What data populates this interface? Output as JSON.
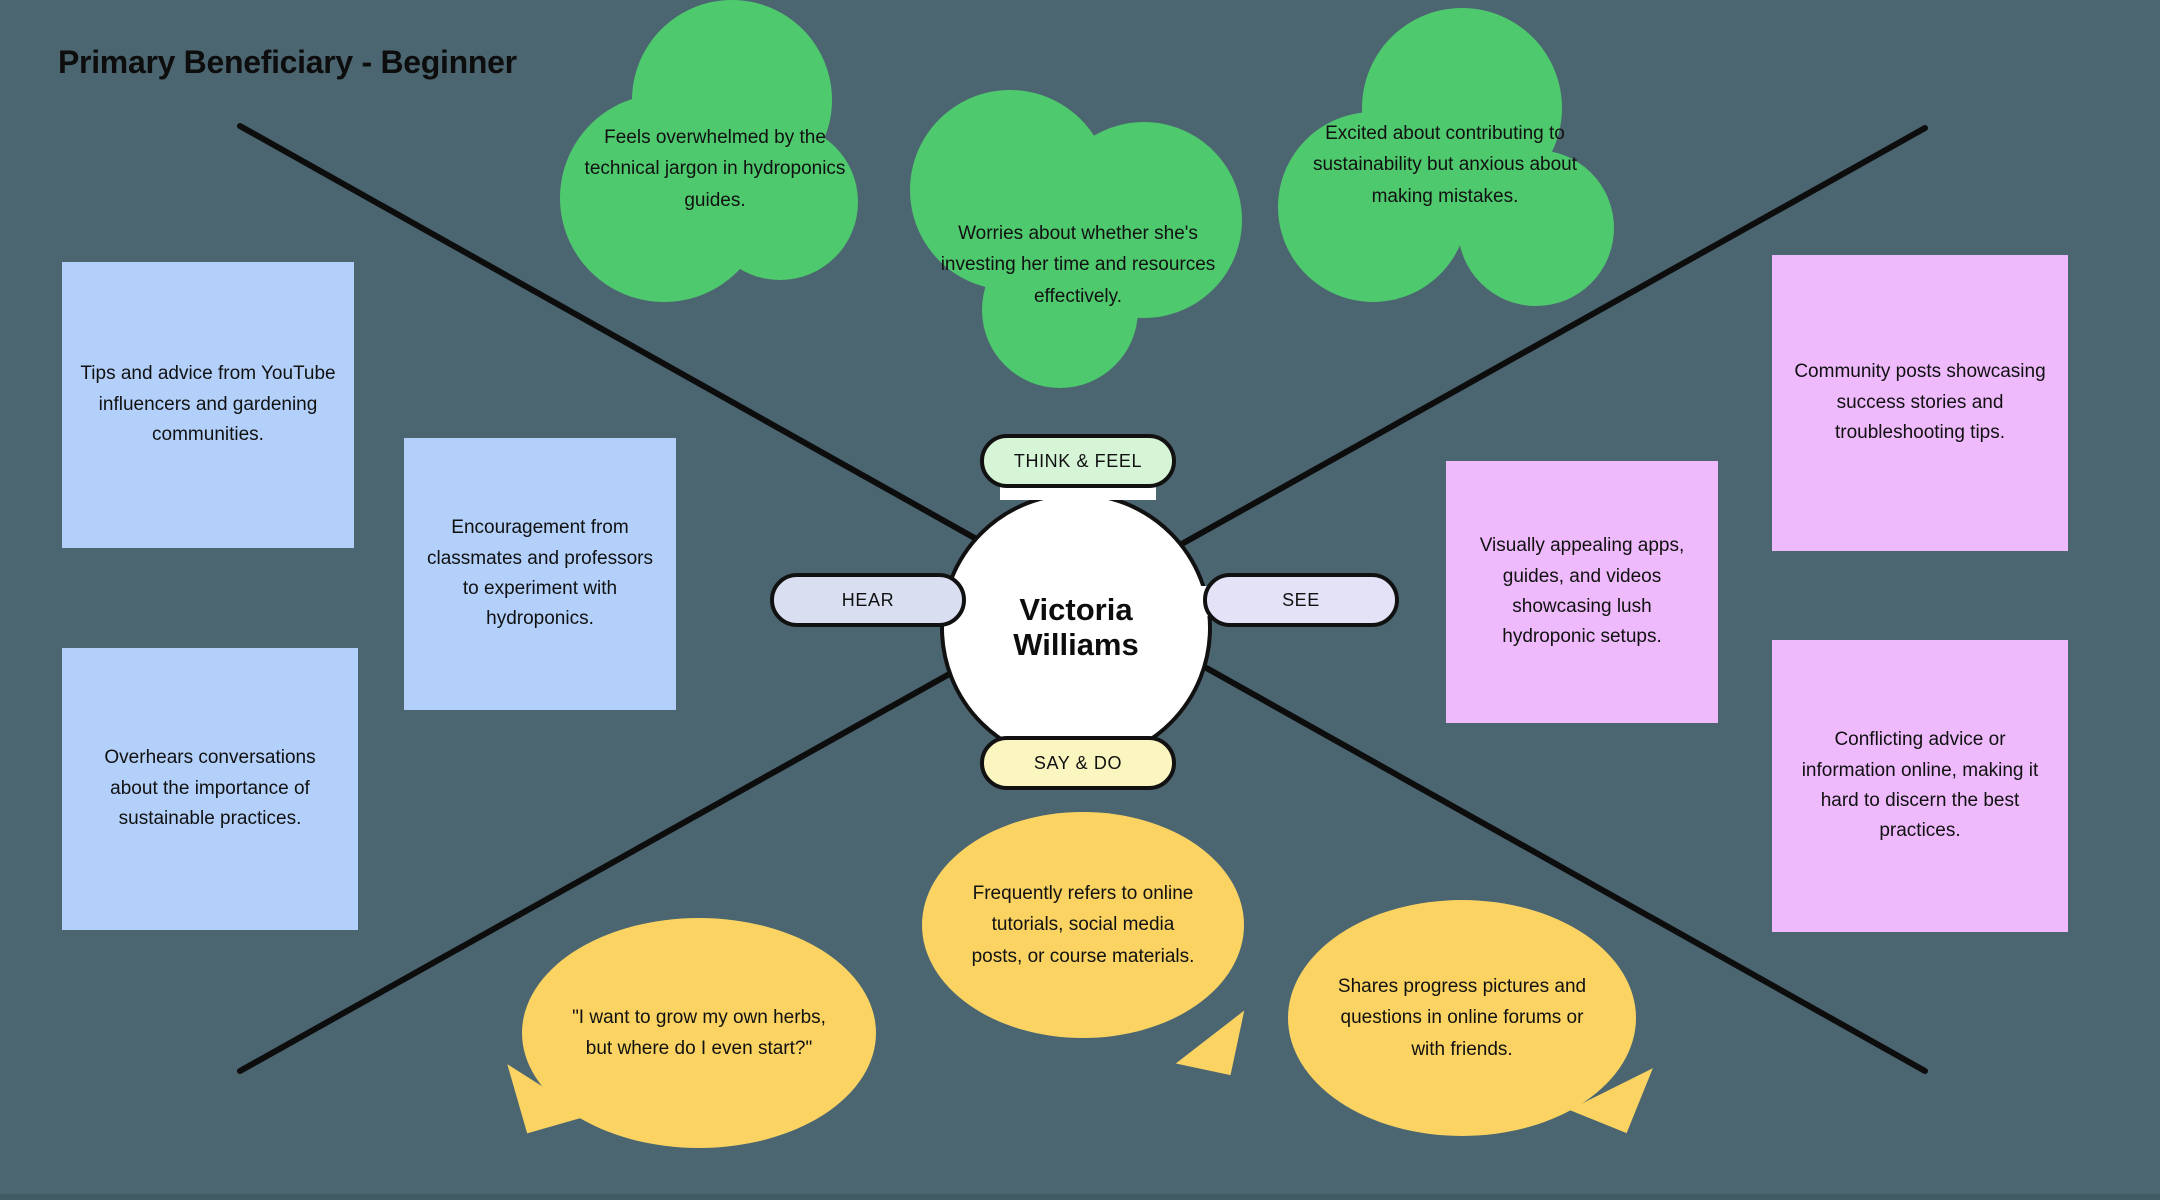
{
  "title": "Primary Beneficiary - Beginner",
  "colors": {
    "background": "#4b6670",
    "hear_note": "#b3d0fb",
    "see_note": "#eebafc",
    "think_cloud": "#4fc96e",
    "say_bubble": "#fad362",
    "hub_fill": "#ffffff",
    "pill_think": "#d5f5d6",
    "pill_say": "#fbf5c0",
    "pill_hear": "#d9dff0",
    "pill_see": "#e3e2f7",
    "outline": "#111111"
  },
  "hub": {
    "persona_line1": "Victoria",
    "persona_line2": "Williams",
    "quadrants": {
      "think_feel": "THINK & FEEL",
      "say_do": "SAY & DO",
      "hear": "HEAR",
      "see": "SEE"
    }
  },
  "think_feel": {
    "items": [
      "Feels overwhelmed by the technical jargon in hydroponics guides.",
      "Worries about whether she's investing her time and resources effectively.",
      "Excited about contributing to sustainability but anxious about making mistakes."
    ]
  },
  "hear": {
    "items": [
      "Tips and advice from YouTube influencers and gardening communities.",
      "Encouragement from classmates and professors to experiment with hydroponics.",
      "Overhears conversations about the importance of sustainable practices."
    ]
  },
  "see": {
    "items": [
      "Community posts showcasing success stories and troubleshooting tips.",
      "Visually appealing apps, guides, and videos showcasing lush hydroponic setups.",
      "Conflicting advice or information online, making it hard to discern the best practices."
    ]
  },
  "say_do": {
    "items": [
      "\"I want to grow my own herbs, but where do I even start?\"",
      "Frequently refers to online tutorials, social media posts, or course materials.",
      "Shares progress pictures and questions in online forums or with friends."
    ]
  }
}
